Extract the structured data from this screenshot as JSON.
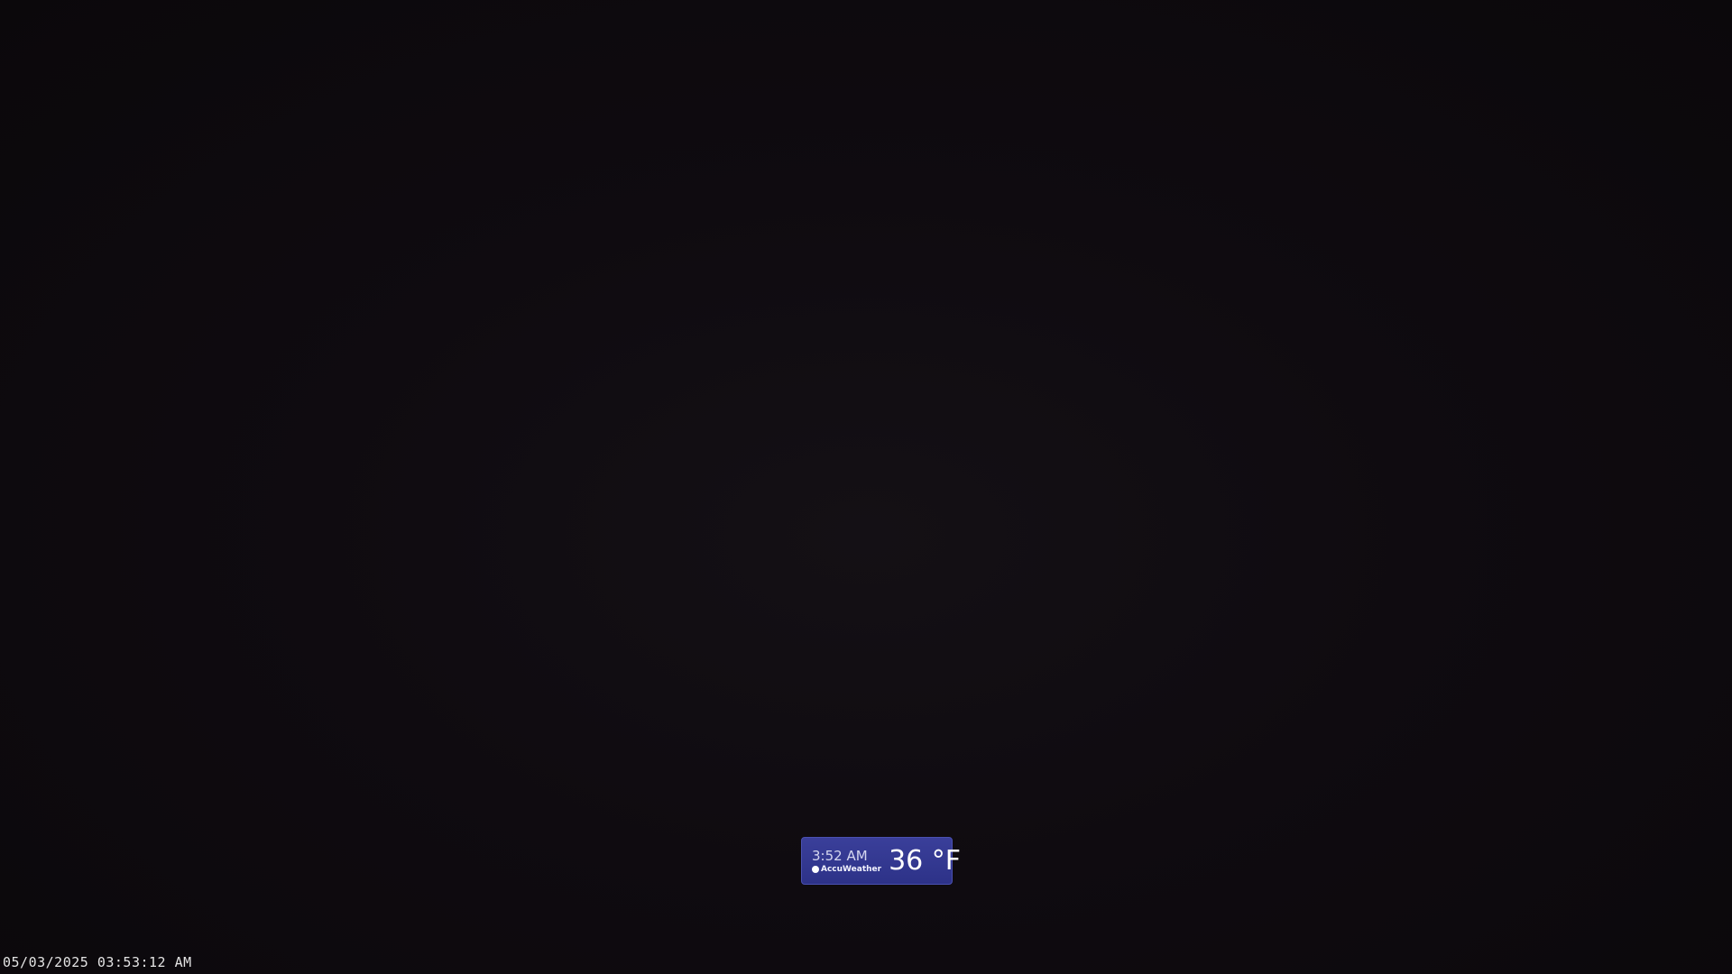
{
  "weather_widget": {
    "time": "3:52 AM",
    "brand": "AccuWeather",
    "brand_icon": "accuweather-sun-icon",
    "temperature": "36 °F",
    "background_color": "#3a3f9a"
  },
  "camera_overlay": {
    "timestamp": "05/03/2025 03:53:12 AM"
  }
}
